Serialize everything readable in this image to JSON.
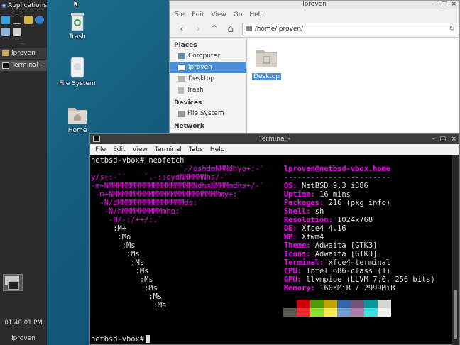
{
  "panel": {
    "applications_label": "Applications",
    "tasks": [
      {
        "label": "lproven"
      },
      {
        "label": "Terminal -"
      }
    ],
    "clock": "01:40:01 PM",
    "user": "lproven"
  },
  "desktop": {
    "icons": [
      {
        "label": "Trash",
        "icon": "trash-icon"
      },
      {
        "label": "File System",
        "icon": "drive-icon"
      },
      {
        "label": "Home",
        "icon": "home-folder-icon"
      }
    ]
  },
  "file_manager": {
    "title": "lproven",
    "menu": [
      "File",
      "Edit",
      "View",
      "Go",
      "Help"
    ],
    "path": "/home/lproven/",
    "places_heading": "Places",
    "places": [
      {
        "label": "Computer",
        "icon": "computer-icon"
      },
      {
        "label": "lproven",
        "icon": "home-icon",
        "selected": true
      },
      {
        "label": "Desktop",
        "icon": "desktop-icon"
      },
      {
        "label": "Trash",
        "icon": "trash-icon"
      }
    ],
    "devices_heading": "Devices",
    "devices": [
      {
        "label": "File System",
        "icon": "drive-icon"
      }
    ],
    "network_heading": "Network",
    "items": [
      {
        "label": "Desktop"
      }
    ]
  },
  "terminal": {
    "title": "Terminal -",
    "menu": [
      "File",
      "Edit",
      "View",
      "Terminal",
      "Tabs",
      "Help"
    ],
    "command_line": "netbsd-vbox# neofetch",
    "prompt": "netbsd-vbox#",
    "logo": [
      "                    `-/oshdmNMNdhyo+:-`",
      "y/s+:-``    `.-:+oydNMMMMNhs/-``",
      "-m+NMMMMMMMMMMMMMMMMMMMNdhmNMMMmdhs+/-`",
      " -m+NMMMMMMMMMMMMMMMMMMMMMMMMmy+:`",
      "  -N/dMMMMMMMMMMMMMMMds:`",
      "   -N/hMMMMMMMMMmho:`",
      "    -N/-:/++/:.`",
      "     :M+",
      "      :Mo",
      "       :Ms",
      "        :Ms",
      "         :Ms",
      "          :Ms",
      "           :Ms",
      "            :Ms",
      "             :Ms",
      "              :Ms"
    ],
    "header": "lproven@netbsd-vbox.home",
    "underline": "------------------------",
    "info": [
      {
        "key": "OS",
        "value": "NetBSD 9.3 i386"
      },
      {
        "key": "Uptime",
        "value": "16 mins"
      },
      {
        "key": "Packages",
        "value": "216 (pkg_info)"
      },
      {
        "key": "Shell",
        "value": "sh"
      },
      {
        "key": "Resolution",
        "value": "1024x768"
      },
      {
        "key": "DE",
        "value": "Xfce4 4.16"
      },
      {
        "key": "WM",
        "value": "Xfwm4"
      },
      {
        "key": "Theme",
        "value": "Adwaita [GTK3]"
      },
      {
        "key": "Icons",
        "value": "Adwaita [GTK3]"
      },
      {
        "key": "Terminal",
        "value": "xfce4-terminal"
      },
      {
        "key": "CPU",
        "value": "Intel 686-class (1)"
      },
      {
        "key": "GPU",
        "value": "llvmpipe (LLVM 7.0, 256 bits)"
      },
      {
        "key": "Memory",
        "value": "1605MiB / 2999MiB"
      }
    ],
    "palette_row1": [
      "#000000",
      "#cc0000",
      "#4e9a06",
      "#c4a000",
      "#3465a4",
      "#75507b",
      "#06989a",
      "#d3d7cf"
    ],
    "palette_row2": [
      "#555753",
      "#ef2929",
      "#8ae234",
      "#fce94f",
      "#729fcf",
      "#ad7fa8",
      "#34e2e2",
      "#eeeeec"
    ]
  },
  "colors": {
    "accent": "#4a90d9",
    "logo": "#ff00ff"
  }
}
